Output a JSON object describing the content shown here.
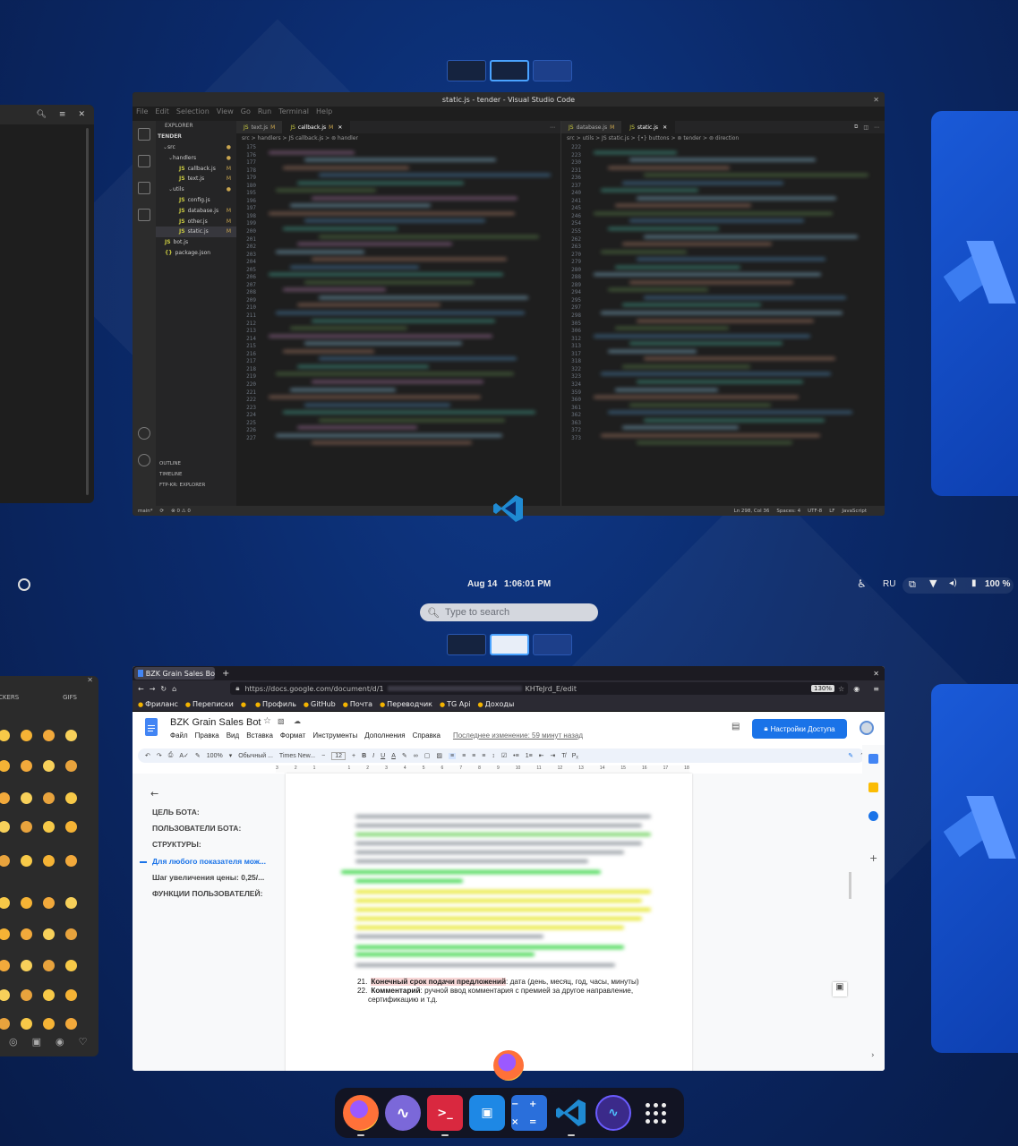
{
  "workspace_top": {
    "vscode": {
      "title": "static.js - tender - Visual Studio Code",
      "menu": [
        "File",
        "Edit",
        "Selection",
        "View",
        "Go",
        "Run",
        "Terminal",
        "Help"
      ],
      "explorer_label": "EXPLORER",
      "tree": [
        {
          "label": "TENDER",
          "kind": "root"
        },
        {
          "label": "src",
          "kind": "folder",
          "dot": true
        },
        {
          "label": "handlers",
          "kind": "folder",
          "dot": true
        },
        {
          "label": "callback.js",
          "kind": "js",
          "mark": "M"
        },
        {
          "label": "text.js",
          "kind": "js",
          "mark": "M"
        },
        {
          "label": "utils",
          "kind": "folder",
          "dot": true
        },
        {
          "label": "config.js",
          "kind": "js",
          "mark": ""
        },
        {
          "label": "database.js",
          "kind": "js",
          "mark": "M"
        },
        {
          "label": "other.js",
          "kind": "js",
          "mark": "M"
        },
        {
          "label": "static.js",
          "kind": "js",
          "mark": "M",
          "selected": true
        },
        {
          "label": "bot.js",
          "kind": "js",
          "mark": ""
        },
        {
          "label": "package.json",
          "kind": "json",
          "mark": ""
        }
      ],
      "bottom_sections": [
        "OUTLINE",
        "TIMELINE",
        "FTP-KR: EXPLORER"
      ],
      "left_pane": {
        "tabs": [
          {
            "label": "text.js",
            "mark": "M",
            "active": false
          },
          {
            "label": "callback.js",
            "mark": "M",
            "active": true
          }
        ],
        "breadcrumb": "src > handlers > JS callback.js > ⊚ handler",
        "lines": [
          "175",
          "176",
          "177",
          "178",
          "179",
          "180",
          "195",
          "196",
          "197",
          "198",
          "199",
          "200",
          "201",
          "202",
          "203",
          "204",
          "205",
          "206",
          "207",
          "208",
          "209",
          "210",
          "211",
          "212",
          "213",
          "214",
          "215",
          "216",
          "217",
          "218",
          "219",
          "220",
          "221",
          "222",
          "223",
          "224",
          "225",
          "226",
          "227"
        ]
      },
      "right_pane": {
        "tabs": [
          {
            "label": "database.js",
            "mark": "M",
            "active": false
          },
          {
            "label": "static.js",
            "mark": "",
            "active": true
          }
        ],
        "breadcrumb": "src > utils > JS static.js > {•} buttons > ⊚ tender > ⊚ direction",
        "lines": [
          "222",
          "223",
          "230",
          "231",
          "236",
          "237",
          "240",
          "241",
          "245",
          "246",
          "254",
          "255",
          "262",
          "263",
          "270",
          "279",
          "280",
          "288",
          "289",
          "294",
          "295",
          "297",
          "298",
          "305",
          "306",
          "312",
          "313",
          "317",
          "318",
          "322",
          "323",
          "324",
          "359",
          "360",
          "361",
          "362",
          "363",
          "372",
          "373"
        ]
      },
      "status_left": [
        "main*",
        "⟳",
        "⊗ 0 ⚠ 0"
      ],
      "status_right": [
        "Ln 298, Col 36",
        "Spaces: 4",
        "UTF-8",
        "LF",
        "JavaScript"
      ]
    }
  },
  "topbar": {
    "date": "Aug 14",
    "time": "1:06:01 PM",
    "lang": "RU",
    "battery": "100 %"
  },
  "search": {
    "placeholder": "Type to search"
  },
  "left_emoji_panel": {
    "tabs": [
      "CKERS",
      "GIFS"
    ]
  },
  "firefox": {
    "tab_title": "BZK Grain Sales Bo",
    "url_prefix": "https://docs.google.com/document/d/1",
    "url_suffix": "KHTeJrd_E/edit",
    "zoom": "130%",
    "bookmarks": [
      "Фриланс",
      "Переписки",
      "",
      "Профиль",
      "GitHub",
      "Почта",
      "Переводчик",
      "TG Api",
      "Доходы"
    ]
  },
  "docs": {
    "title": "BZK Grain Sales Bot",
    "menu": [
      "Файл",
      "Правка",
      "Вид",
      "Вставка",
      "Формат",
      "Инструменты",
      "Дополнения",
      "Справка"
    ],
    "last_edit": "Последнее изменение: 59 минут назад",
    "share_button": "Настройки Доступа",
    "toolbar": {
      "zoom": "100%",
      "style": "Обычный ...",
      "font": "Times New...",
      "size": "12"
    },
    "ruler": [
      "3",
      "2",
      "1",
      "",
      "1",
      "2",
      "3",
      "4",
      "5",
      "6",
      "7",
      "8",
      "9",
      "10",
      "11",
      "12",
      "13",
      "14",
      "15",
      "16",
      "17",
      "18"
    ],
    "outline": [
      {
        "label": "ЦЕЛЬ БОТА:",
        "active": false
      },
      {
        "label": "ПОЛЬЗОВАТЕЛИ БОТА:",
        "active": false
      },
      {
        "label": "СТРУКТУРЫ:",
        "active": false
      },
      {
        "label": "Для любого показателя мож...",
        "active": true
      },
      {
        "label": "Шаг увеличения цены: 0,25/...",
        "active": false
      },
      {
        "label": "ФУНКЦИИ ПОЛЬЗОВАТЕЛЕЙ:",
        "active": false
      }
    ],
    "item21_num": "21.",
    "item21_bold": "Конечный срок подачи предложений",
    "item21_rest": ": дата (день, месяц, год, часы, минуты)",
    "item22_num": "22.",
    "item22_bold": "Комментарий",
    "item22_rest": ": ручной ввод комментария с премией за другое направление,",
    "item22_cont": "сертификацию и т.д."
  },
  "dock": [
    {
      "name": "firefox",
      "running": true,
      "color": "#ff7139"
    },
    {
      "name": "mastodon-like",
      "running": false,
      "color": "#6d5bd0"
    },
    {
      "name": "terminal",
      "running": true,
      "color": "#d9283f"
    },
    {
      "name": "store",
      "running": false,
      "color": "#1e88e5"
    },
    {
      "name": "calculator",
      "running": false,
      "color": "#2a6fdb"
    },
    {
      "name": "vscode",
      "running": true,
      "color": "#0078d4"
    },
    {
      "name": "system-monitor",
      "running": false,
      "color": "#3b2a8a"
    },
    {
      "name": "app-grid",
      "running": false,
      "color": "transparent"
    }
  ]
}
